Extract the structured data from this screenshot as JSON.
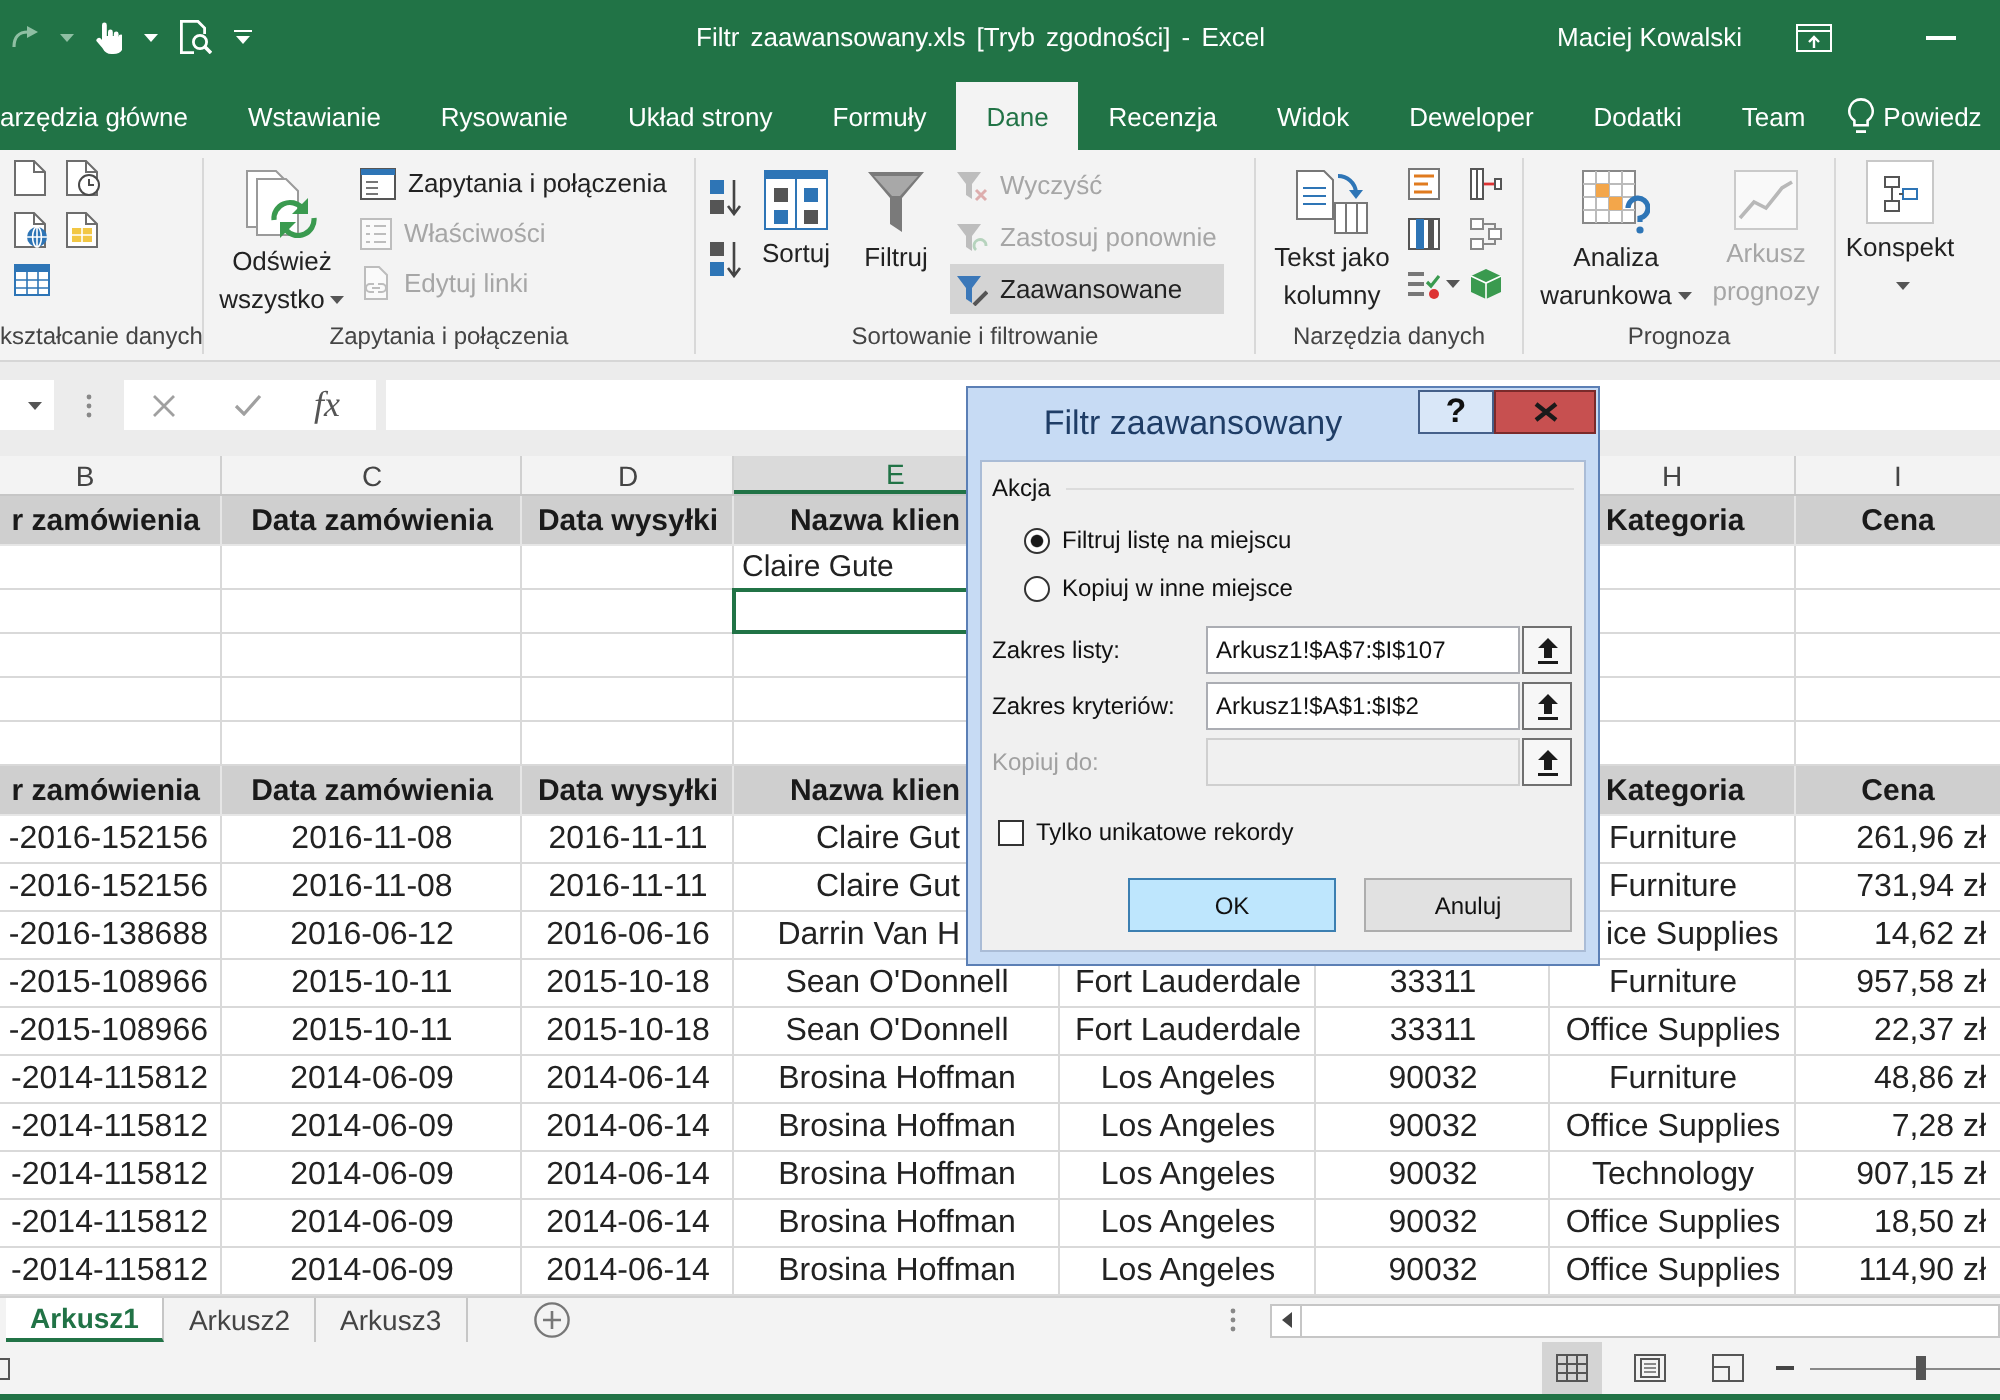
{
  "title_bar": {
    "title": "Filtr zaawansowany.xls [Tryb zgodności] - Excel",
    "user": "Maciej Kowalski"
  },
  "ribbon_tabs": [
    {
      "label": "arzędzia główne",
      "selected": false
    },
    {
      "label": "Wstawianie",
      "selected": false
    },
    {
      "label": "Rysowanie",
      "selected": false
    },
    {
      "label": "Układ strony",
      "selected": false
    },
    {
      "label": "Formuły",
      "selected": false
    },
    {
      "label": "Dane",
      "selected": true
    },
    {
      "label": "Recenzja",
      "selected": false
    },
    {
      "label": "Widok",
      "selected": false
    },
    {
      "label": "Deweloper",
      "selected": false
    },
    {
      "label": "Dodatki",
      "selected": false
    },
    {
      "label": "Team",
      "selected": false
    }
  ],
  "tell_me": {
    "label": "Powiedz"
  },
  "ribbon": {
    "get_transform": {
      "label": "kształcanie danych"
    },
    "queries": {
      "refresh": {
        "label": "Odśwież wszystko",
        "menu": true,
        "disabled": false
      },
      "items": [
        {
          "label": "Zapytania i połączenia",
          "disabled": false
        },
        {
          "label": "Właściwości",
          "disabled": true
        },
        {
          "label": "Edytuj linki",
          "disabled": true
        }
      ],
      "label": "Zapytania i połączenia"
    },
    "sort_filter": {
      "sort": {
        "label": "Sortuj",
        "menu": false,
        "disabled": false
      },
      "filter": {
        "label": "Filtruj",
        "menu": false,
        "disabled": false
      },
      "items": [
        {
          "label": "Wyczyść",
          "disabled": true,
          "highlighted": false
        },
        {
          "label": "Zastosuj ponownie",
          "disabled": true,
          "highlighted": false
        },
        {
          "label": "Zaawansowane",
          "disabled": false,
          "highlighted": true
        }
      ],
      "label": "Sortowanie i filtrowanie"
    },
    "data_tools": {
      "text_to_columns": {
        "label": "Tekst jako kolumny",
        "menu": false,
        "disabled": false
      },
      "label": "Narzędzia danych"
    },
    "forecast": {
      "what_if": {
        "label": "Analiza warunkowa",
        "menu": true,
        "disabled": false
      },
      "forecast_sheet": {
        "label": "Arkusz prognozy",
        "menu": false,
        "disabled": true
      },
      "label": "Prognoza"
    },
    "outline": {
      "button": {
        "label": "Konspekt",
        "menu": true,
        "disabled": false
      }
    }
  },
  "formula_bar": {
    "function_button": "fx"
  },
  "sheet": {
    "column_headers": [
      {
        "label": "B",
        "selected": false
      },
      {
        "label": "C",
        "selected": false
      },
      {
        "label": "D",
        "selected": false
      },
      {
        "label": "E",
        "selected": true
      },
      {
        "label": "H",
        "selected": false
      },
      {
        "label": "I",
        "selected": false
      }
    ],
    "rows": [
      {
        "kind": "header",
        "selected": false,
        "cells": [
          "r zamówienia",
          "Data zamówienia",
          "Data wysyłki",
          "Nazwa klien",
          null,
          null,
          "Kategoria",
          "Cena"
        ]
      },
      {
        "kind": "criteria",
        "selected": false,
        "cells": [
          null,
          null,
          null,
          "Claire Gute",
          null,
          null,
          null,
          null
        ]
      },
      {
        "kind": "blank",
        "selected": true
      },
      {
        "kind": "blank",
        "selected": false
      },
      {
        "kind": "blank",
        "selected": false
      },
      {
        "kind": "blank",
        "selected": false
      },
      {
        "kind": "header",
        "selected": false,
        "cells": [
          "r zamówienia",
          "Data zamówienia",
          "Data wysyłki",
          "Nazwa klien",
          null,
          null,
          "Kategoria",
          "Cena"
        ]
      },
      {
        "kind": "data",
        "selected": false,
        "cells": [
          "-2016-152156",
          "2016-11-08",
          "2016-11-11",
          "Claire Gut",
          null,
          null,
          "Furniture",
          "261,96 zł"
        ]
      },
      {
        "kind": "data",
        "selected": false,
        "cells": [
          "-2016-152156",
          "2016-11-08",
          "2016-11-11",
          "Claire Gut",
          null,
          null,
          "Furniture",
          "731,94 zł"
        ]
      },
      {
        "kind": "data",
        "selected": false,
        "cells": [
          "-2016-138688",
          "2016-06-12",
          "2016-06-16",
          "Darrin Van H",
          null,
          null,
          "ice Supplies",
          "14,62 zł"
        ]
      },
      {
        "kind": "data",
        "selected": false,
        "cells": [
          "-2015-108966",
          "2015-10-11",
          "2015-10-18",
          "Sean O'Donnell",
          "Fort Lauderdale",
          "33311",
          "Furniture",
          "957,58 zł"
        ]
      },
      {
        "kind": "data",
        "selected": false,
        "cells": [
          "-2015-108966",
          "2015-10-11",
          "2015-10-18",
          "Sean O'Donnell",
          "Fort Lauderdale",
          "33311",
          "Office Supplies",
          "22,37 zł"
        ]
      },
      {
        "kind": "data",
        "selected": false,
        "cells": [
          "-2014-115812",
          "2014-06-09",
          "2014-06-14",
          "Brosina Hoffman",
          "Los Angeles",
          "90032",
          "Furniture",
          "48,86 zł"
        ]
      },
      {
        "kind": "data",
        "selected": false,
        "cells": [
          "-2014-115812",
          "2014-06-09",
          "2014-06-14",
          "Brosina Hoffman",
          "Los Angeles",
          "90032",
          "Office Supplies",
          "7,28 zł"
        ]
      },
      {
        "kind": "data",
        "selected": false,
        "cells": [
          "-2014-115812",
          "2014-06-09",
          "2014-06-14",
          "Brosina Hoffman",
          "Los Angeles",
          "90032",
          "Technology",
          "907,15 zł"
        ]
      },
      {
        "kind": "data",
        "selected": false,
        "cells": [
          "-2014-115812",
          "2014-06-09",
          "2014-06-14",
          "Brosina Hoffman",
          "Los Angeles",
          "90032",
          "Office Supplies",
          "18,50 zł"
        ]
      },
      {
        "kind": "data",
        "selected": false,
        "cells": [
          "-2014-115812",
          "2014-06-09",
          "2014-06-14",
          "Brosina Hoffman",
          "Los Angeles",
          "90032",
          "Office Supplies",
          "114,90 zł"
        ]
      }
    ]
  },
  "dialog": {
    "title": "Filtr zaawansowany",
    "help": "?",
    "group_label": "Akcja",
    "options": [
      {
        "label": "Filtruj listę na miejscu",
        "selected": true
      },
      {
        "label": "Kopiuj w inne miejsce",
        "selected": false
      }
    ],
    "fields": [
      {
        "label": "Zakres listy:",
        "value": "Arkusz1!$A$7:$I$107",
        "disabled": false
      },
      {
        "label": "Zakres kryteriów:",
        "value": "Arkusz1!$A$1:$I$2",
        "disabled": false
      },
      {
        "label": "Kopiuj do:",
        "disabled": true
      }
    ],
    "unique_only": {
      "label": "Tylko unikatowe rekordy",
      "checked": false
    },
    "buttons": [
      {
        "label": "OK",
        "default": true
      },
      {
        "label": "Anuluj",
        "default": false
      }
    ]
  },
  "sheet_tabs": [
    {
      "label": "Arkusz1",
      "selected": true
    },
    {
      "label": "Arkusz2",
      "selected": false
    },
    {
      "label": "Arkusz3",
      "selected": false
    }
  ],
  "status_bar": {
    "views": [
      {
        "kind": "normal",
        "selected": true
      },
      {
        "kind": "page_layout",
        "selected": false
      },
      {
        "kind": "page_break",
        "selected": false
      }
    ],
    "zoom": {
      "level": 0.58
    }
  }
}
